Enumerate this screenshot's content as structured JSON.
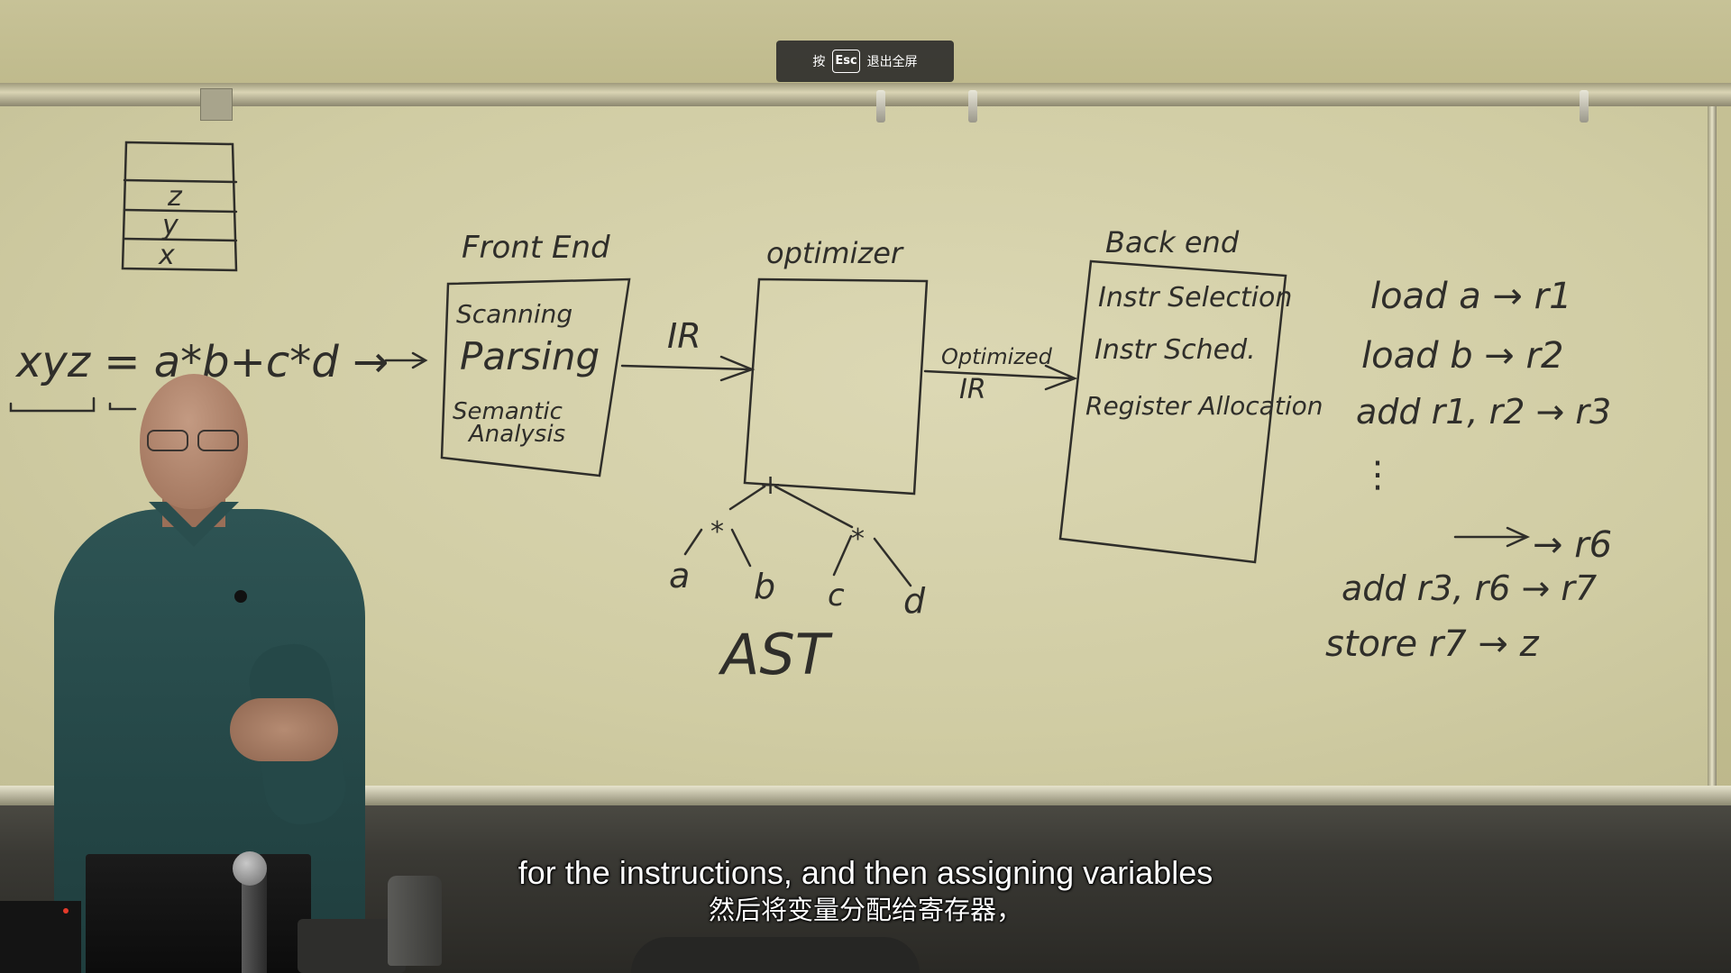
{
  "overlay": {
    "press": "按",
    "key": "Esc",
    "action": "退出全屏"
  },
  "subtitles": {
    "english": "for the instructions, and then assigning variables",
    "chinese": "然后将变量分配给寄存器，"
  },
  "board": {
    "stack": [
      "z",
      "y",
      "x"
    ],
    "expression": "xyz = a*b+c*d →",
    "frontend": {
      "title": "Front End",
      "items": [
        "Scanning",
        "Parsing",
        "Semantic",
        "Analysis"
      ]
    },
    "ir_label": "IR",
    "optimizer": {
      "title": "optimizer"
    },
    "optimized_ir": [
      "Optimized",
      "IR"
    ],
    "backend": {
      "title": "Back end",
      "items": [
        "Instr Selection",
        "Instr Sched.",
        "Register Allocation"
      ]
    },
    "ast": {
      "label": "AST",
      "nodes": [
        "+",
        "*",
        "*",
        "a",
        "b",
        "c",
        "d"
      ]
    },
    "code": [
      "load a → r1",
      "load b → r2",
      "add r1, r2 → r3",
      "⋮",
      "→ r6",
      "add r3, r6 → r7",
      "store r7 → z"
    ]
  }
}
